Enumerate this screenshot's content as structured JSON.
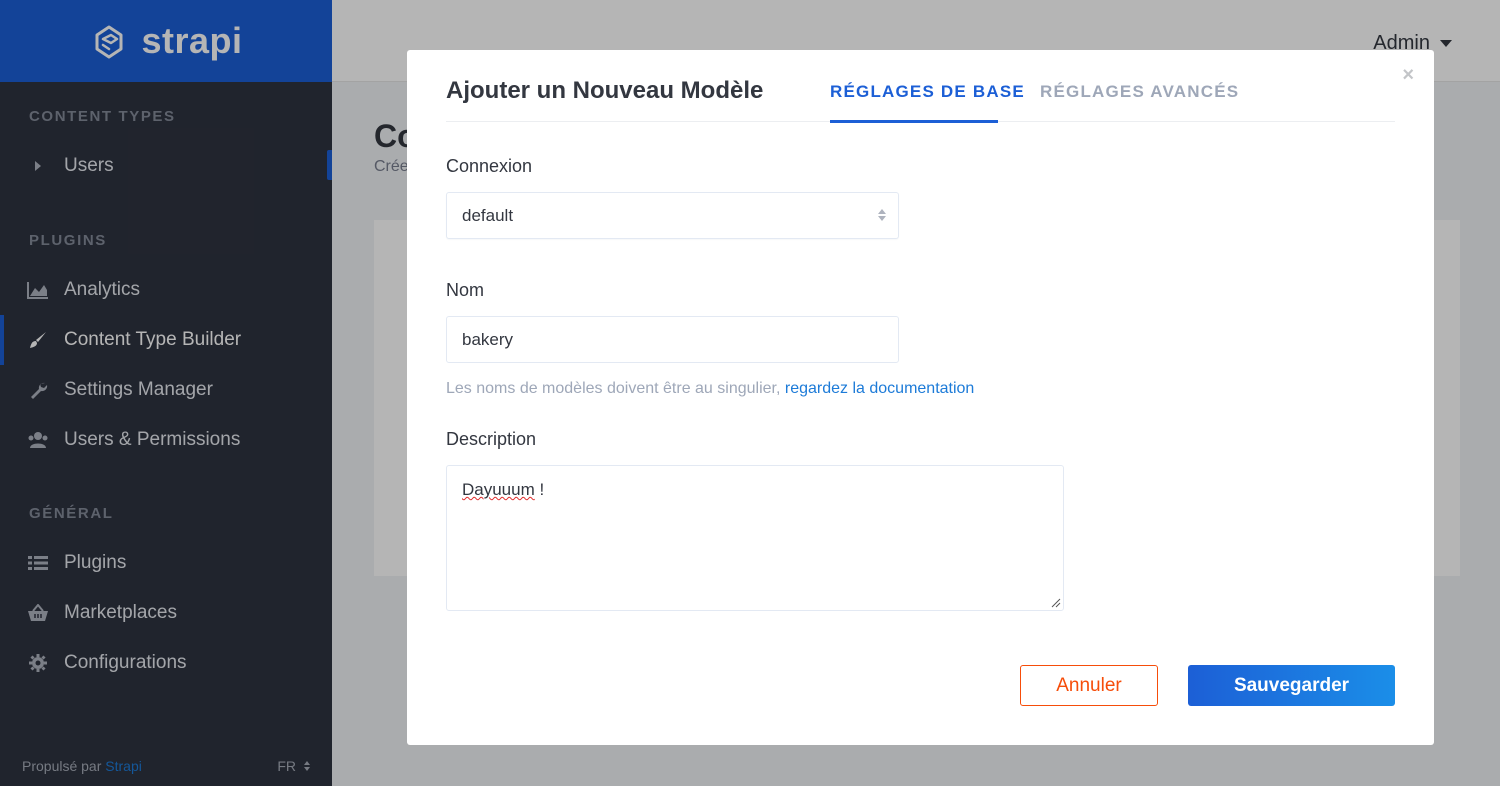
{
  "brand": {
    "name": "strapi"
  },
  "sidebar": {
    "sections": [
      {
        "title": "CONTENT TYPES",
        "items": [
          {
            "label": "Users",
            "icon": "caret-right-icon"
          }
        ]
      },
      {
        "title": "PLUGINS",
        "items": [
          {
            "label": "Analytics",
            "icon": "area-chart-icon"
          },
          {
            "label": "Content Type Builder",
            "icon": "paint-brush-icon"
          },
          {
            "label": "Settings Manager",
            "icon": "wrench-icon"
          },
          {
            "label": "Users & Permissions",
            "icon": "users-icon"
          }
        ]
      },
      {
        "title": "GÉNÉRAL",
        "items": [
          {
            "label": "Plugins",
            "icon": "list-icon"
          },
          {
            "label": "Marketplaces",
            "icon": "basket-icon"
          },
          {
            "label": "Configurations",
            "icon": "gear-icon"
          }
        ]
      }
    ],
    "footer": {
      "powered_prefix": "Propulsé par",
      "powered_link": "Strapi",
      "language": "FR"
    }
  },
  "header": {
    "user": "Admin"
  },
  "background": {
    "title": "Co",
    "subtitle": "Crée"
  },
  "modal": {
    "title": "Ajouter un Nouveau Modèle",
    "tabs": [
      {
        "label": "RÉGLAGES DE BASE",
        "active": true
      },
      {
        "label": "RÉGLAGES AVANCÉS",
        "active": false
      }
    ],
    "close": "×",
    "connection": {
      "label": "Connexion",
      "value": "default"
    },
    "name": {
      "label": "Nom",
      "value": "bakery"
    },
    "hint": {
      "text": "Les noms de modèles doivent être au singulier, ",
      "link": "regardez la documentation"
    },
    "description": {
      "label": "Description",
      "value_word": "Dayuuum",
      "value_rest": " !"
    },
    "cancel": "Annuler",
    "save": "Sauvegarder"
  },
  "colors": {
    "accent": "#1c5fd6",
    "danger": "#f64d0a",
    "sidebar": "#2e3340"
  }
}
